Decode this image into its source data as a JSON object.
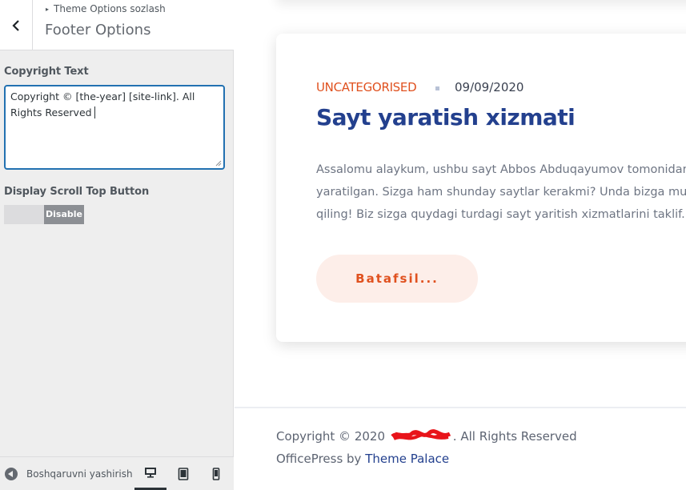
{
  "sidebar": {
    "breadcrumb": "Theme Options sozlash",
    "section_title": "Footer Options",
    "copyright_label": "Copyright Text",
    "copyright_value": "Copyright © [the-year] [site-link]. All Rights Reserved",
    "scroll_label": "Display Scroll Top Button",
    "toggle_label": "Disable",
    "collapse_label": "Boshqaruvni yashirish",
    "devices": [
      "desktop-icon",
      "tablet-icon",
      "mobile-icon"
    ]
  },
  "preview": {
    "category": "UNCATEGORISED",
    "date": "09/09/2020",
    "title": "Sayt yaratish xizmati",
    "excerpt_lines": [
      "Assalomu alaykum, ushbu sayt Abbos Abduqayumov tomonidan",
      "yaratilgan. Sizga ham shunday saytlar kerakmi? Unda bizga murojaat",
      "qiling! Biz sizga quydagi turdagi sayt yaritish xizmatlarini taklif..."
    ],
    "more_button": "Batafsil...",
    "copyright_prefix": "Copyright © 2020",
    "copyright_suffix": ". All Rights Reserved",
    "credit_prefix": "OfficePress by",
    "credit_link": "Theme Palace"
  },
  "colors": {
    "accent": "#e0511f",
    "title_blue": "#23408e",
    "focus_blue": "#2271b1"
  }
}
